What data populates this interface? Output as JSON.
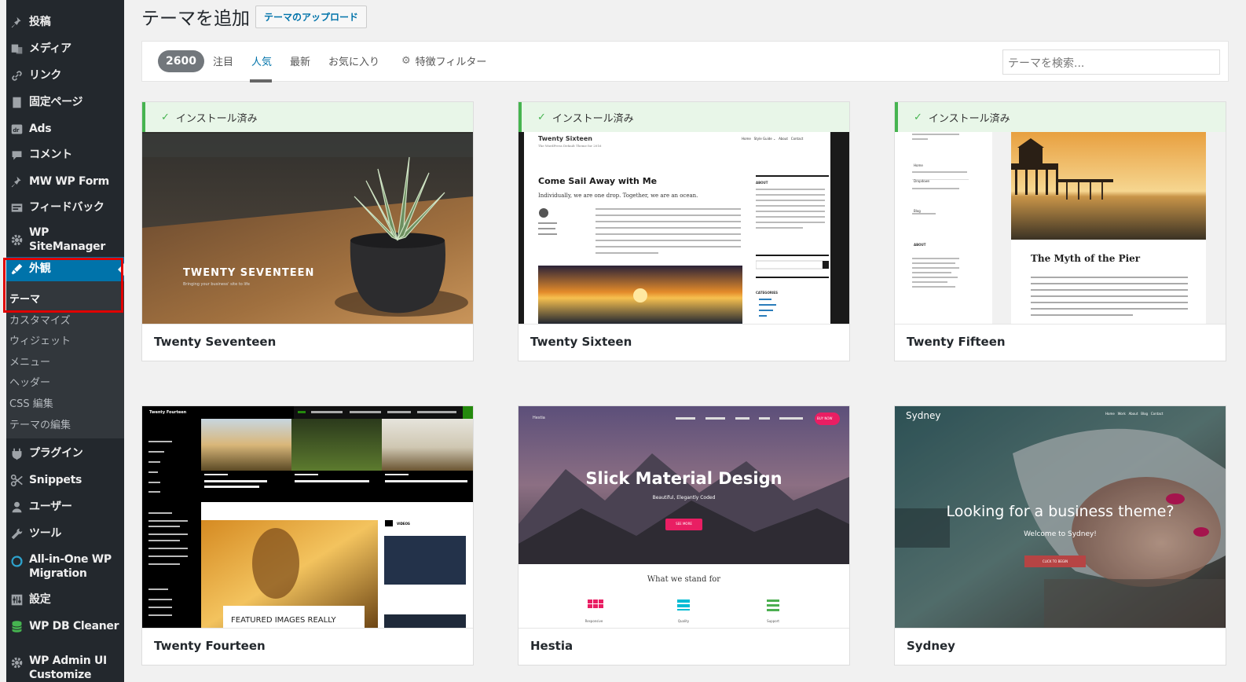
{
  "sidebar": {
    "items": [
      {
        "label": "投稿",
        "icon": "pin-icon"
      },
      {
        "label": "メディア",
        "icon": "media-icon"
      },
      {
        "label": "リンク",
        "icon": "link-icon"
      },
      {
        "label": "固定ページ",
        "icon": "page-icon"
      },
      {
        "label": "Ads",
        "icon": "ads-icon"
      },
      {
        "label": "コメント",
        "icon": "comment-icon"
      },
      {
        "label": "MW WP Form",
        "icon": "pin-icon"
      },
      {
        "label": "フィードバック",
        "icon": "feedback-icon"
      },
      {
        "label": "WP SiteManager",
        "icon": "gear-icon"
      },
      {
        "label": "外観",
        "icon": "appearance-icon"
      }
    ],
    "submenu": [
      "テーマ",
      "カスタマイズ",
      "ウィジェット",
      "メニュー",
      "ヘッダー",
      "CSS 編集",
      "テーマの編集"
    ],
    "items2": [
      {
        "label": "プラグイン",
        "icon": "plugin-icon"
      },
      {
        "label": "Snippets",
        "icon": "scissors-icon"
      },
      {
        "label": "ユーザー",
        "icon": "user-icon"
      },
      {
        "label": "ツール",
        "icon": "wrench-icon"
      },
      {
        "label": "All-in-One WP\nMigration",
        "icon": "migration-icon"
      },
      {
        "label": "設定",
        "icon": "settings-icon"
      },
      {
        "label": "WP DB Cleaner",
        "icon": "database-icon"
      },
      {
        "label": "WP Admin UI\nCustomize",
        "icon": "gear-icon"
      }
    ]
  },
  "header": {
    "title": "テーマを追加",
    "upload_label": "テーマのアップロード"
  },
  "filter": {
    "count": "2600",
    "tabs": [
      "注目",
      "人気",
      "最新",
      "お気に入り"
    ],
    "active_tab": "人気",
    "feature_filter": "特徴フィルター",
    "search_placeholder": "テーマを検索..."
  },
  "installed_label": "インストール済み",
  "themes": [
    {
      "name": "Twenty Seventeen",
      "installed": true
    },
    {
      "name": "Twenty Sixteen",
      "installed": true
    },
    {
      "name": "Twenty Fifteen",
      "installed": true
    },
    {
      "name": "Twenty Fourteen",
      "installed": false
    },
    {
      "name": "Hestia",
      "installed": false
    },
    {
      "name": "Sydney",
      "installed": false
    }
  ],
  "previews": {
    "t17": {
      "title": "TWENTY SEVENTEEN",
      "tagline": "Bringing your business' site to life"
    },
    "t16": {
      "site": "Twenty Sixteen",
      "tagline": "The WordPress Default Theme for 2016",
      "nav": "Home   Style Guide ⌄   About   Contact",
      "post_title": "Come Sail Away with Me",
      "post_lead": "Individually, we are one drop. Together, we are an ocean.",
      "sidebar_about": "ABOUT",
      "sidebar_categories": "CATEGORIES"
    },
    "t15": {
      "post_title": "The Myth of the Pier",
      "nav_home": "Home",
      "nav_dropdown": "Dropdown",
      "nav_blog": "Blog",
      "about": "ABOUT"
    },
    "t14": {
      "site": "Twenty Fourteen",
      "feature": "FEATURED IMAGES REALLY",
      "videos": "VIDEOS"
    },
    "hestia": {
      "title": "Slick Material Design",
      "subtitle": "Beautiful, Elegantly Coded",
      "button": "SEE MORE",
      "section": "What we stand for",
      "features": [
        "Responsive",
        "Quality",
        "Support"
      ],
      "logo": "Hestia",
      "buy": "BUY NOW"
    },
    "sydney": {
      "logo": "Sydney",
      "headline": "Looking for a business theme?",
      "welcome": "Welcome to Sydney!",
      "button": "CLICK TO BEGIN",
      "nav": "Home   Work   About   Blog   Contact"
    }
  },
  "colors": {
    "accent": "#0073aa",
    "sidebar": "#23282d",
    "installed_green": "#46b450",
    "highlight_border": "#e00000"
  }
}
